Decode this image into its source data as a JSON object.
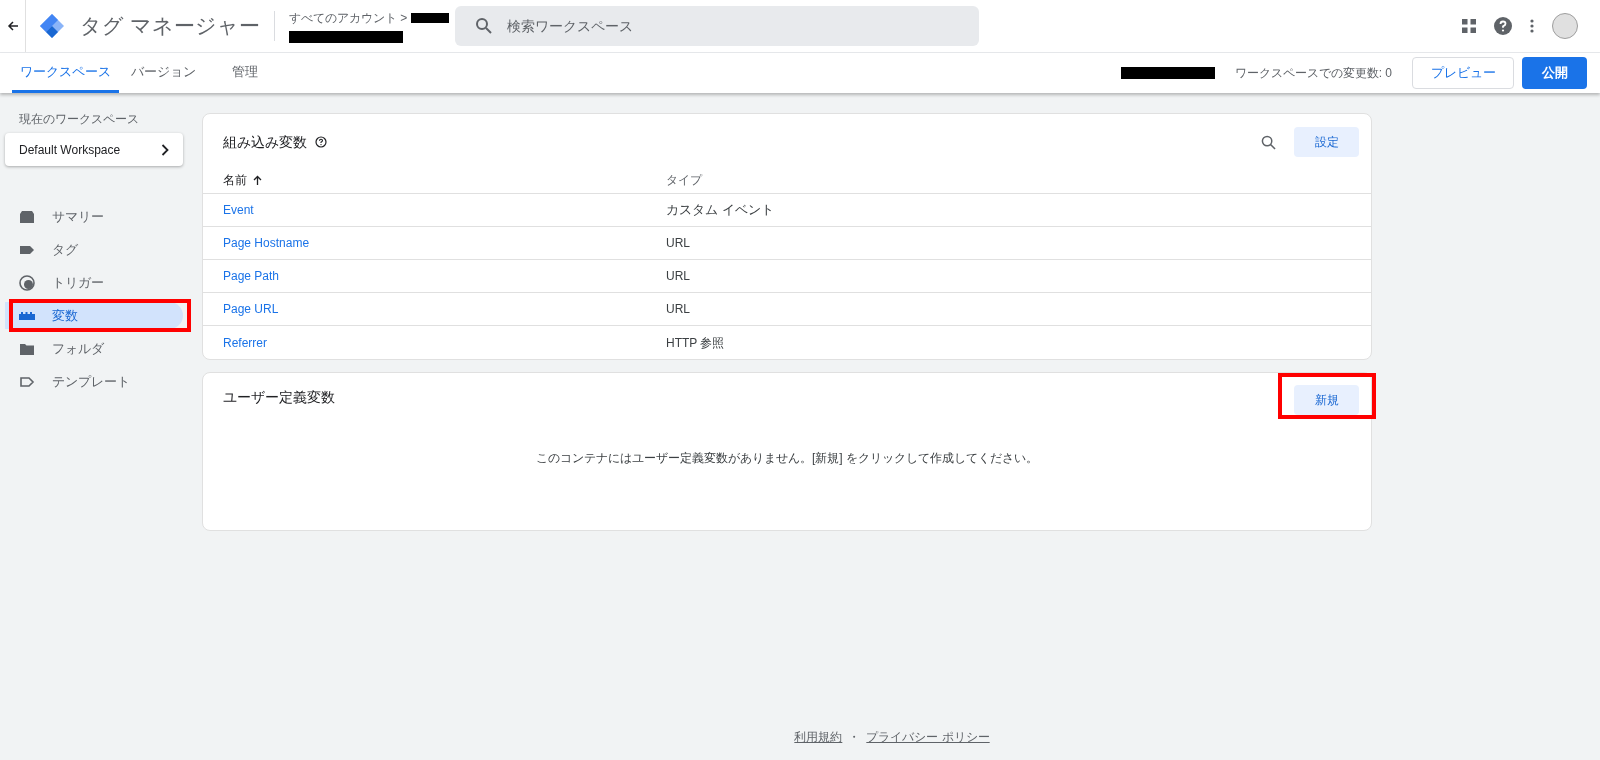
{
  "header": {
    "title": "タグ マネージャー",
    "breadcrumb": "すべてのアカウント >",
    "search": {
      "placeholder": "検索ワークスペース"
    }
  },
  "tabs": [
    {
      "label": "ワークスペース",
      "selected": true
    },
    {
      "label": "バージョン",
      "selected": false
    },
    {
      "label": "管理",
      "selected": false
    }
  ],
  "toolbar": {
    "changes": "ワークスペースでの変更数: 0",
    "preview": "プレビュー",
    "publish": "公開"
  },
  "sidebar": {
    "workspace_label": "現在のワークスペース",
    "workspace": "Default Workspace",
    "items": [
      {
        "kind": "summary",
        "label": "サマリー",
        "selected": false
      },
      {
        "kind": "tag",
        "label": "タグ",
        "selected": false
      },
      {
        "kind": "trigger",
        "label": "トリガー",
        "selected": false
      },
      {
        "kind": "variable",
        "label": "変数",
        "selected": true,
        "highlighted": true
      },
      {
        "kind": "folder",
        "label": "フォルダ",
        "selected": false
      },
      {
        "kind": "template",
        "label": "テンプレート",
        "selected": false
      }
    ]
  },
  "builtin": {
    "title": "組み込み変数",
    "configure": "設定",
    "columns": [
      "名前",
      "タイプ"
    ],
    "rows": [
      {
        "name": "Event",
        "type": "カスタム イベント"
      },
      {
        "name": "Page Hostname",
        "type": "URL"
      },
      {
        "name": "Page Path",
        "type": "URL"
      },
      {
        "name": "Page URL",
        "type": "URL"
      },
      {
        "name": "Referrer",
        "type": "HTTP 参照"
      }
    ]
  },
  "user_defined": {
    "title": "ユーザー定義変数",
    "new": "新規",
    "new_highlighted": true,
    "empty": "このコンテナにはユーザー定義変数がありません。[新規] をクリックして作成してください。"
  },
  "footer": {
    "links": [
      "利用規約",
      "プライバシー ポリシー"
    ],
    "separator": "・"
  }
}
